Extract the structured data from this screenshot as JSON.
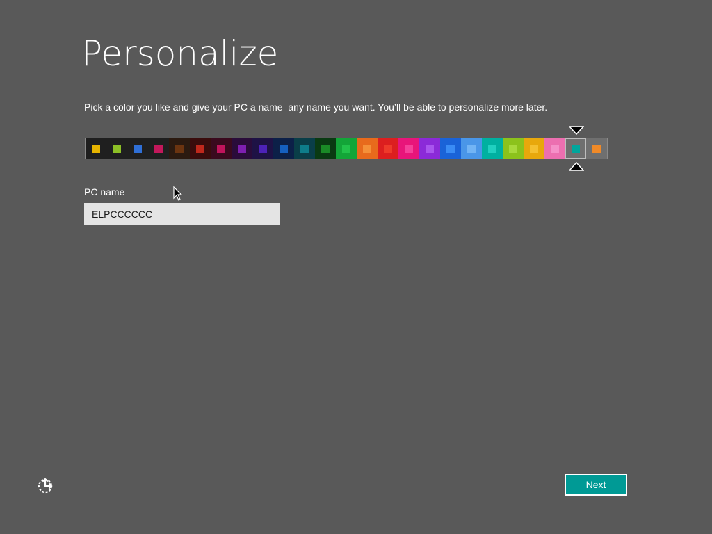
{
  "header": {
    "title": "Personalize",
    "subtitle": "Pick a color you like and give your PC a name–any name you want. You’ll be able to personalize more later."
  },
  "colors": {
    "selected_index": 23,
    "swatches": [
      {
        "bg": "#1f1f1f",
        "chip": "#e6b400"
      },
      {
        "bg": "#1f1f1f",
        "chip": "#8cbf26"
      },
      {
        "bg": "#1f1f1f",
        "chip": "#2f6fd6"
      },
      {
        "bg": "#1f1f1f",
        "chip": "#c2185b"
      },
      {
        "bg": "#2b1a10",
        "chip": "#6b3410"
      },
      {
        "bg": "#3a0c0c",
        "chip": "#c0281c"
      },
      {
        "bg": "#3a0a1e",
        "chip": "#c0145c"
      },
      {
        "bg": "#2a0c3a",
        "chip": "#7e1fb0"
      },
      {
        "bg": "#1e1245",
        "chip": "#4d22b8"
      },
      {
        "bg": "#0c2048",
        "chip": "#1560c0"
      },
      {
        "bg": "#0a3e48",
        "chip": "#0e7d8a"
      },
      {
        "bg": "#0a3a12",
        "chip": "#1a8a26"
      },
      {
        "bg": "#13a538",
        "chip": "#22c24a"
      },
      {
        "bg": "#e86a1c",
        "chip": "#f59038"
      },
      {
        "bg": "#dc1f1f",
        "chip": "#ee3a2a"
      },
      {
        "bg": "#e8157a",
        "chip": "#f5409a"
      },
      {
        "bg": "#8b2ad8",
        "chip": "#a955ee"
      },
      {
        "bg": "#1a63d8",
        "chip": "#3a8cf5"
      },
      {
        "bg": "#4a96e8",
        "chip": "#72b4f5"
      },
      {
        "bg": "#00b0a0",
        "chip": "#20d0c0"
      },
      {
        "bg": "#8cc21c",
        "chip": "#a8d93c"
      },
      {
        "bg": "#e8a80c",
        "chip": "#f5c030"
      },
      {
        "bg": "#ec6fb0",
        "chip": "#f590c8"
      },
      {
        "bg": "#6f6f6f",
        "chip": "#00a69c"
      },
      {
        "bg": "#6f6f6f",
        "chip": "#f08a28"
      }
    ]
  },
  "pc_name": {
    "label": "PC name",
    "value": "ELPCCCCCC"
  },
  "footer": {
    "next_label": "Next",
    "ease_icon": "ease-of-access-icon",
    "next_color": "#009a95"
  },
  "theme": {
    "background": "#595959"
  }
}
